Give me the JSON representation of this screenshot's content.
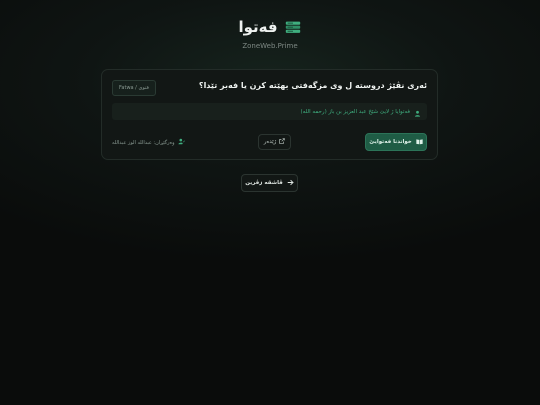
{
  "header": {
    "title": "فەتوا",
    "subtitle": "ZoneWeb.Prime",
    "icon": "books-stack-icon"
  },
  "card": {
    "tag": "Fatwa / فتوى",
    "question": "ئەری نڤێژ دروستە ل وی مزگەفتی بهێتە کرن یا فەبر تێدا؟",
    "info_text": "فەتوایا ژ لایێ شێخ عبد العزیز بن باز (رحمه الله)",
    "read_button": "خواندنا فەتوایێ",
    "source_button": "ژێدەر",
    "author": "وەرگێڕان: عبدالله الوز عبدالله"
  },
  "footer": {
    "back_button": "ڤاشقە زڤرین"
  },
  "colors": {
    "accent": "#1f5c45",
    "accent_text": "#3fae7f",
    "card_bg": "#121715"
  }
}
